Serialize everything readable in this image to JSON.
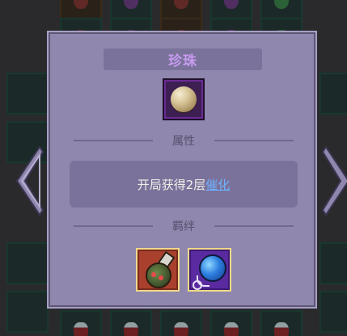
{
  "item": {
    "name": "珍珠",
    "icon": "pearl-icon"
  },
  "sections": {
    "attributes_label": "属性",
    "bonds_label": "羁绊"
  },
  "description": {
    "text": "开局获得2层",
    "link_text": "催化"
  },
  "bonds": [
    {
      "icon": "potion-icon",
      "frame_color": "#a8402d"
    },
    {
      "icon": "balloon-orb-icon",
      "frame_color": "#5a2aa0"
    }
  ],
  "navigation": {
    "prev_icon": "chevron-left-icon",
    "next_icon": "chevron-right-icon"
  },
  "colors": {
    "panel": "#8f87ad",
    "title": "#c79bf0",
    "link": "#6fb0ff",
    "bond_border": "#f0d98a"
  }
}
